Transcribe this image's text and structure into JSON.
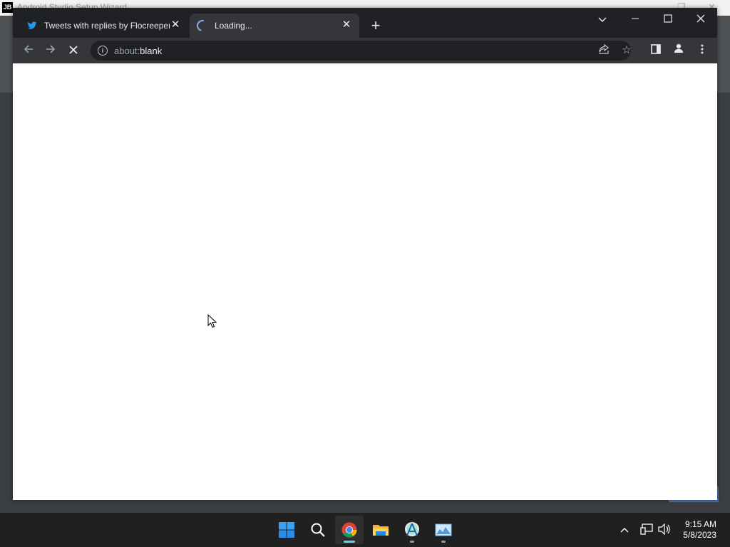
{
  "background_app": {
    "title": "Android Studio Setup Wizard",
    "logo": "JB"
  },
  "browser": {
    "tabs": [
      {
        "title": "Tweets with replies by Flocreeper",
        "favicon": "twitter-icon"
      },
      {
        "title": "Loading...",
        "favicon": "loading-spinner"
      }
    ],
    "address": {
      "scheme": "about:",
      "path": "blank"
    },
    "icons": {
      "back": "arrow-left-icon",
      "forward": "arrow-right-icon",
      "stop": "close-icon",
      "share": "share-icon",
      "bookmark": "star-icon",
      "side_panel": "side-panel-icon",
      "profile": "profile-icon",
      "menu": "kebab-menu-icon"
    },
    "colors": {
      "tabstrip": "#202124",
      "toolbar": "#35363a",
      "twitter_blue": "#1d9bf0"
    }
  },
  "taskbar": {
    "apps": [
      {
        "name": "Start",
        "icon": "windows-start-icon"
      },
      {
        "name": "Search",
        "icon": "search-icon"
      },
      {
        "name": "Google Chrome",
        "icon": "chrome-icon",
        "active": true
      },
      {
        "name": "File Explorer",
        "icon": "folder-icon"
      },
      {
        "name": "Android Studio",
        "icon": "android-studio-icon"
      },
      {
        "name": "Image Viewer",
        "icon": "image-icon"
      }
    ],
    "clock": {
      "time": "9:15 AM",
      "date": "5/8/2023"
    }
  }
}
